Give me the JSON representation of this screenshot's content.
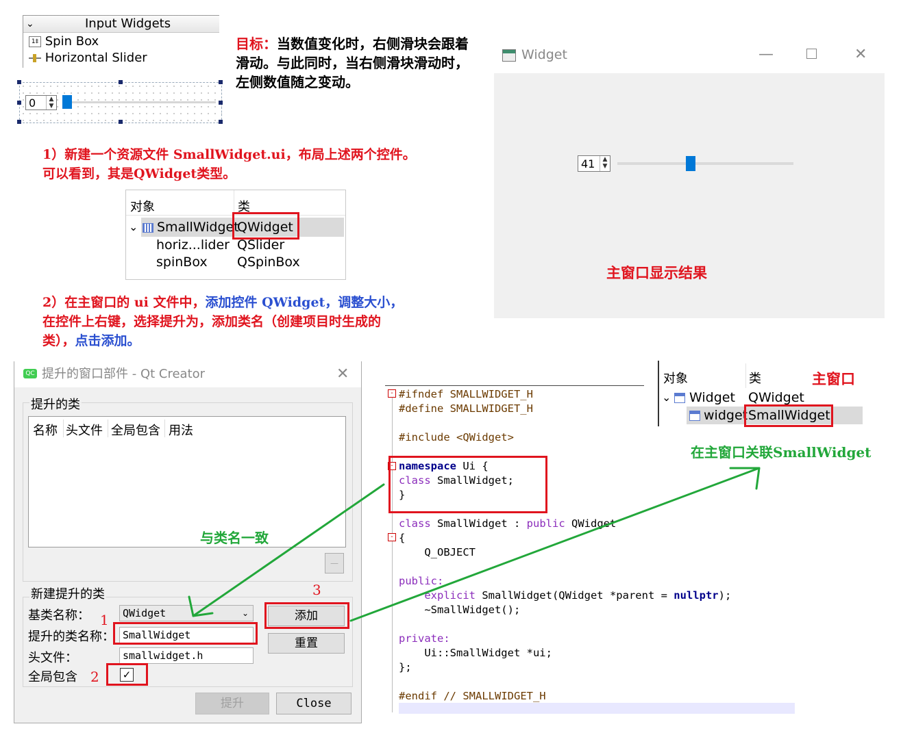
{
  "input_widgets": {
    "header": "Input Widgets",
    "items": [
      "Spin Box",
      "Horizontal Slider"
    ]
  },
  "design_preview": {
    "spin_value": "0"
  },
  "goal_text": {
    "label": "目标：",
    "body": "当数值变化时，右侧滑块会跟着滑动。与此同时，当右侧滑块滑动时，左侧数值随之变动。"
  },
  "step1": {
    "line1": "1）新建一个资源文件 SmallWidget.ui，布局上述两个控件。",
    "line2": "可以看到，其是QWidget类型。"
  },
  "object_table_1": {
    "col_object": "对象",
    "col_class": "类",
    "rows": [
      {
        "object": "SmallWidget",
        "class": "QWidget"
      },
      {
        "object": "horiz...lider",
        "class": "QSlider"
      },
      {
        "object": "spinBox",
        "class": "QSpinBox"
      }
    ]
  },
  "step2": {
    "line1_a": "2）在主窗口的 ui 文件中，",
    "line1_b": "添加控件 QWidget，调整大小，",
    "line2": "在控件上右键，选择提升为，添加类名（创建项目时生成的",
    "line3_a": "类），",
    "line3_b": "点击添加。"
  },
  "widget_window": {
    "title": "Widget",
    "spin_value": "41",
    "slider_fraction": 0.41,
    "caption": "主窗口显示结果"
  },
  "dialog": {
    "title": "提升的窗口部件 - Qt Creator",
    "promoted_group": "提升的类",
    "columns": [
      "名称",
      "头文件",
      "全局包含",
      "用法"
    ],
    "new_group": "新建提升的类",
    "base_class_label": "基类名称：",
    "base_class_value": "QWidget",
    "promoted_name_label": "提升的类名称：",
    "promoted_name_value": "SmallWidget",
    "header_label": "头文件：",
    "header_value": "smallwidget.h",
    "global_include_label": "全局包含",
    "add_button": "添加",
    "reset_button": "重置",
    "promote_button": "提升",
    "close_button": "Close",
    "remove_button": "—"
  },
  "annotations": {
    "same_as_class": "与类名一致",
    "num1": "1",
    "num2": "2",
    "num3": "3",
    "main_window": "主窗口",
    "associate": "在主窗口关联SmallWidget"
  },
  "object_table_2": {
    "col_object": "对象",
    "col_class": "类",
    "rows": [
      {
        "object": "Widget",
        "class": "QWidget"
      },
      {
        "object": "widget",
        "class": "SmallWidget"
      }
    ]
  },
  "code": {
    "l1": "#ifndef SMALLWIDGET_H",
    "l2": "#define SMALLWIDGET_H",
    "l3": "#include <QWidget>",
    "l4_kw": "namespace",
    "l4_rest": " Ui {",
    "l5_kw": "class",
    "l5_rest": " SmallWidget;",
    "l6": "}",
    "l7_kw": "class",
    "l7_mid": " SmallWidget : ",
    "l7_kw2": "public",
    "l7_rest": " QWidget",
    "l8": "{",
    "l9": "    Q_OBJECT",
    "l10": "public:",
    "l11_kw": "    explicit",
    "l11_mid": " SmallWidget(QWidget *parent = ",
    "l11_null": "nullptr",
    "l11_end": ");",
    "l12": "    ~SmallWidget();",
    "l13": "private:",
    "l14": "    Ui::SmallWidget *ui;",
    "l15": "};",
    "l16_a": "#endif",
    "l16_b": " // SMALLWIDGET_H"
  },
  "colors": {
    "annotation_red": "#e0141e",
    "annotation_green": "#22a73a",
    "highlight_blue": "#2a4fd0",
    "slider_blue": "#0078d7"
  }
}
